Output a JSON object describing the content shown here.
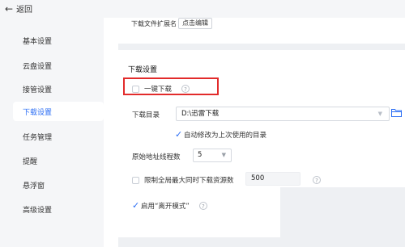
{
  "header": {
    "back_label": "返回",
    "back_icon": "arrow-left-icon"
  },
  "sidebar": {
    "items": [
      {
        "label": "基本设置",
        "active": false
      },
      {
        "label": "云盘设置",
        "active": false
      },
      {
        "label": "接管设置",
        "active": false
      },
      {
        "label": "下载设置",
        "active": true
      },
      {
        "label": "任务管理",
        "active": false
      },
      {
        "label": "提醒",
        "active": false
      },
      {
        "label": "悬浮窗",
        "active": false
      },
      {
        "label": "高级设置",
        "active": false
      }
    ]
  },
  "main": {
    "file_ext": {
      "label": "下载文件扩展名",
      "button": "点击编辑"
    },
    "download_section": {
      "title": "下载设置",
      "one_click": {
        "label": "一键下载",
        "checked": false
      },
      "directory": {
        "label": "下载目录",
        "value": "D:\\迅雷下载"
      },
      "auto_modify": {
        "label": "自动修改为上次使用的目录",
        "checked": true
      },
      "threads": {
        "label": "原始地址线程数",
        "value": "5"
      },
      "limit": {
        "label": "限制全局最大同时下载资源数",
        "value": "500",
        "checked": false
      },
      "leave_mode": {
        "label": "启用“离开模式”",
        "checked": true
      }
    }
  },
  "colors": {
    "accent": "#2a6df4",
    "highlight": "#e22b2b",
    "sidebar_bg": "#f5f6f8"
  }
}
